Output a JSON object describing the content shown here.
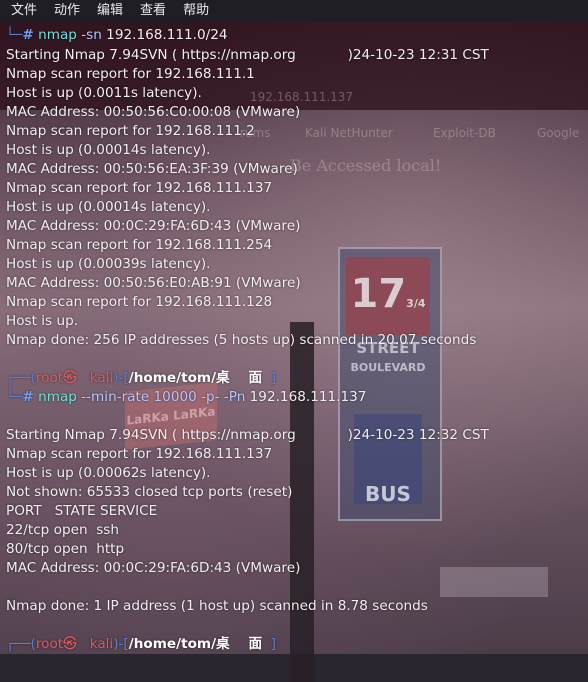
{
  "menubar": {
    "items": [
      "文件",
      "动作",
      "编辑",
      "查看",
      "帮助"
    ]
  },
  "background": {
    "ghost_ip": "192.168.111.137",
    "ghost_tabs": [
      "rums",
      "Kali NetHunter",
      "Exploit-DB",
      "Google"
    ],
    "ghost_text": "Be Accessed local!",
    "sign_number": "17",
    "sign_fraction": "3/4",
    "sign_street": "STREET",
    "sign_boulevard": "BOULEVARD",
    "sign_bus": "BUS",
    "cube_text": "LaRKa LaRKa"
  },
  "terminal": {
    "first_prompt": {
      "corner": "└─",
      "hash": "#",
      "cmd": "nmap",
      "args": " -sn ",
      "target": "192.168.111.0/24"
    },
    "scan1": [
      "Starting Nmap 7.94SVN ( https://nmap.org            )24-10-23 12:31 CST",
      "Nmap scan report for 192.168.111.1",
      "Host is up (0.0011s latency).",
      "MAC Address: 00:50:56:C0:00:08 (VMware)",
      "Nmap scan report for 192.168.111.2",
      "Host is up (0.00014s latency).",
      "MAC Address: 00:50:56:EA:3F:39 (VMware)",
      "Nmap scan report for 192.168.111.137",
      "Host is up (0.00014s latency).",
      "MAC Address: 00:0C:29:FA:6D:43 (VMware)",
      "Nmap scan report for 192.168.111.254",
      "Host is up (0.00039s latency).",
      "MAC Address: 00:50:56:E0:AB:91 (VMware)",
      "Nmap scan report for 192.168.111.128",
      "Host is up.",
      "Nmap done: 256 IP addresses (5 hosts up) scanned in 20.07 seconds"
    ],
    "prompt2_top": {
      "open": "┌──(",
      "user": "root㉿",
      "space": "   ",
      "host": "kali",
      "mid": ")-[",
      "path": "/home/tom/桌    面",
      "close": "  ]"
    },
    "prompt2_bottom": {
      "corner": "└─",
      "hash": "#",
      "cmd": "nmap",
      "args": " --min-rate 10000 -p- -Pn ",
      "target": "192.168.111.137"
    },
    "scan2": [
      "Starting Nmap 7.94SVN ( https://nmap.org            )24-10-23 12:32 CST",
      "Nmap scan report for 192.168.111.137",
      "Host is up (0.00062s latency).",
      "Not shown: 65533 closed tcp ports (reset)",
      "PORT   STATE SERVICE",
      "22/tcp open  ssh",
      "80/tcp open  http",
      "MAC Address: 00:0C:29:FA:6D:43 (VMware)",
      "",
      "Nmap done: 1 IP address (1 host up) scanned in 8.78 seconds"
    ],
    "prompt3_top": {
      "open": "┌──(",
      "user": "root㉿",
      "space": "   ",
      "host": "kali",
      "mid": ")-[",
      "path": "/home/tom/桌    面",
      "close": "  ]"
    }
  }
}
